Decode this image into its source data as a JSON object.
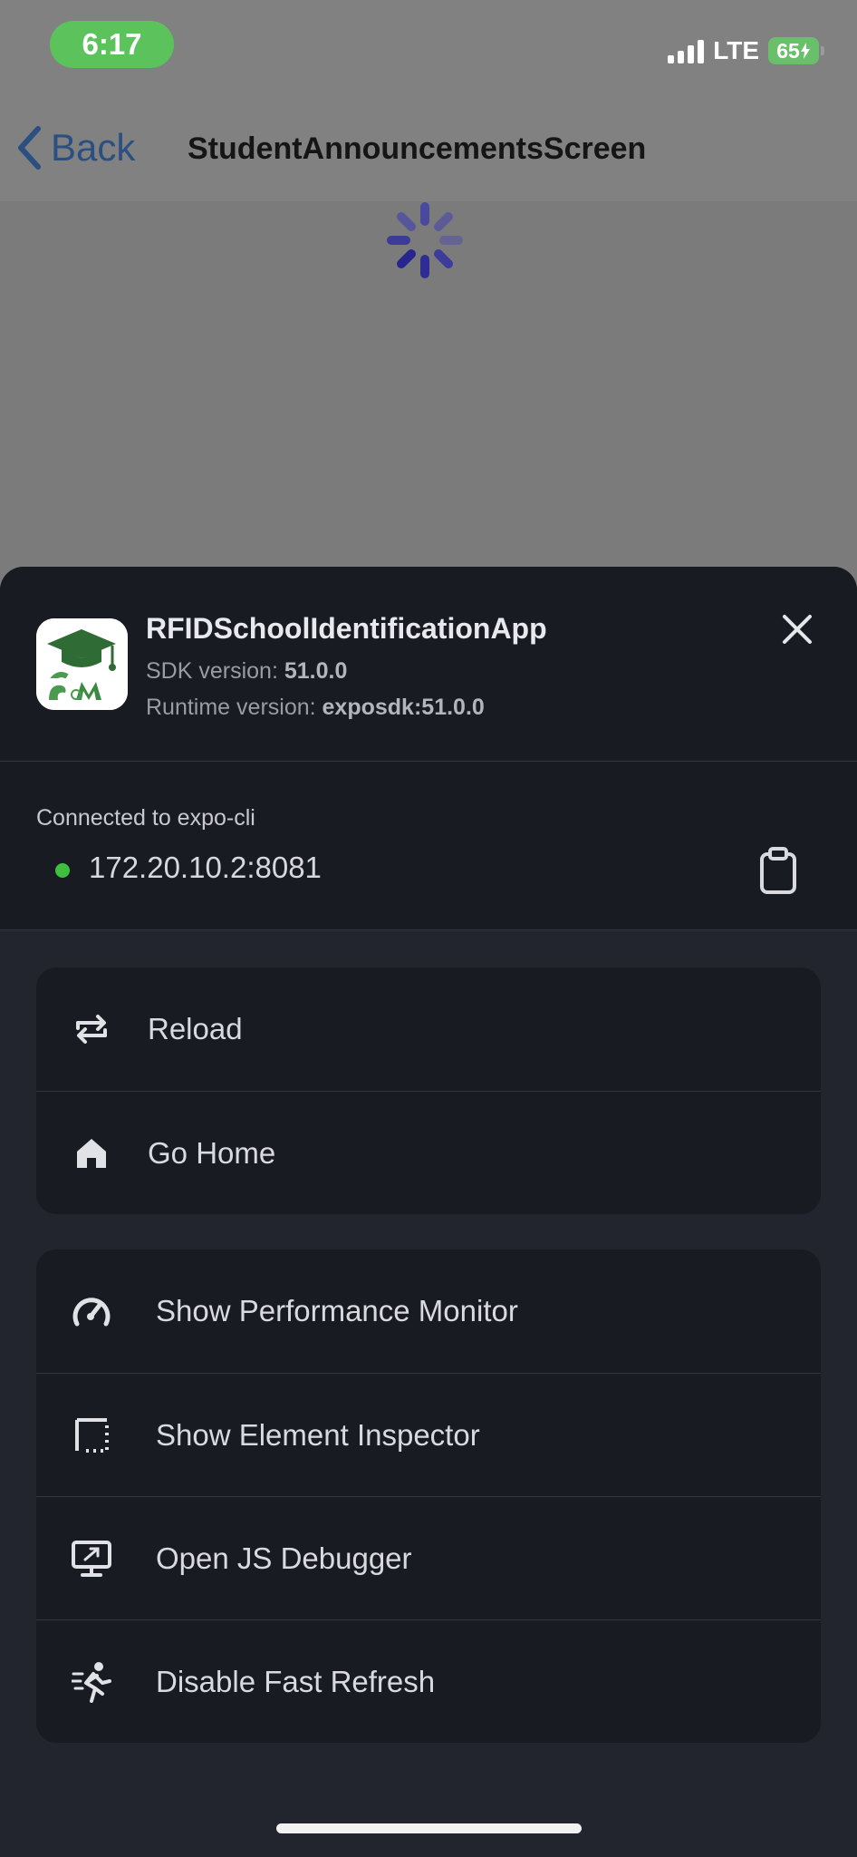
{
  "status_bar": {
    "time": "6:17",
    "network": "LTE",
    "battery": "65"
  },
  "nav": {
    "back_label": "Back",
    "title": "StudentAnnouncementsScreen"
  },
  "dev_menu": {
    "app_name": "RFIDSchoolIdentificationApp",
    "sdk_label": "SDK version:",
    "sdk_value": "51.0.0",
    "runtime_label": "Runtime version:",
    "runtime_value": "exposdk:51.0.0",
    "connection_label": "Connected to expo-cli",
    "server_url": "172.20.10.2:8081",
    "primary_actions": [
      {
        "label": "Reload",
        "icon": "reload-icon"
      },
      {
        "label": "Go Home",
        "icon": "home-icon"
      }
    ],
    "tool_actions": [
      {
        "label": "Show Performance Monitor",
        "icon": "speedometer-icon"
      },
      {
        "label": "Show Element Inspector",
        "icon": "inspect-icon"
      },
      {
        "label": "Open JS Debugger",
        "icon": "debugger-icon"
      },
      {
        "label": "Disable Fast Refresh",
        "icon": "running-icon"
      }
    ]
  },
  "colors": {
    "sheet_bg": "#22252e",
    "card_bg": "#191b22",
    "status_pill": "#5cc35c",
    "connected_dot": "#3fbf3f",
    "back_link": "#2a4f80",
    "spinner": "#27268f"
  }
}
